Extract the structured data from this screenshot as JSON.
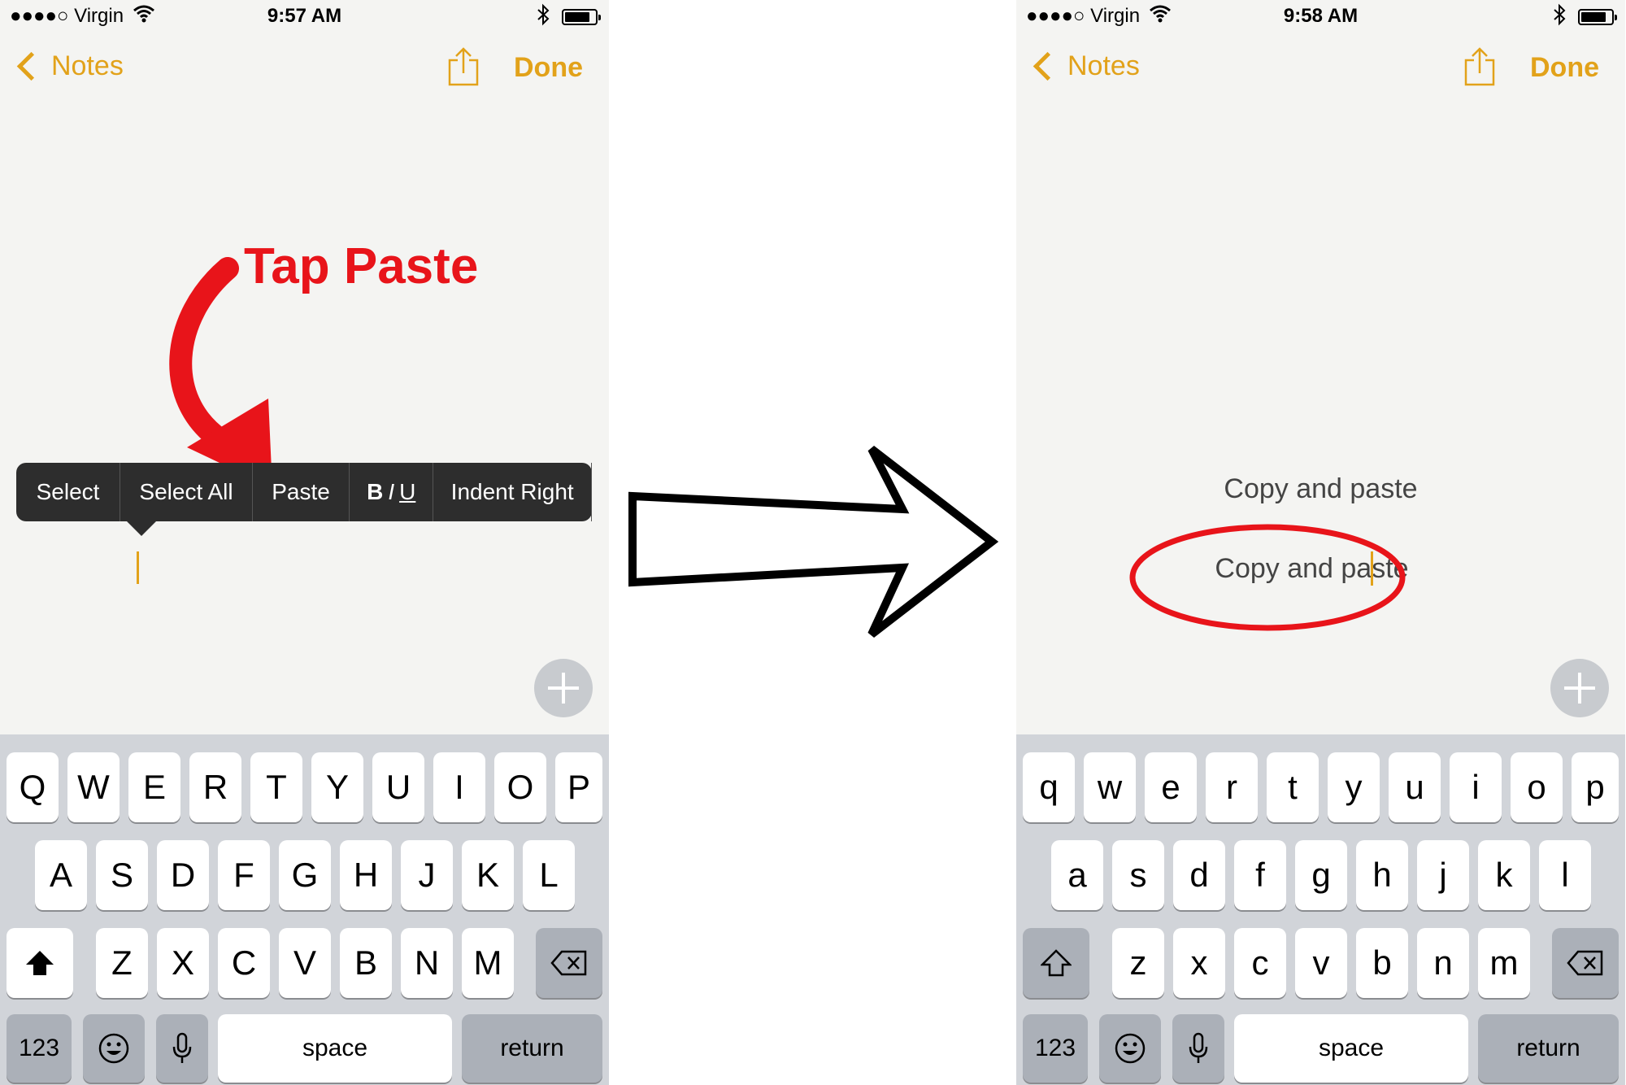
{
  "left": {
    "status": {
      "carrier": "●●●●○ Virgin",
      "time": "9:57 AM"
    },
    "nav": {
      "back_label": "Notes",
      "done_label": "Done"
    },
    "menu": {
      "select": "Select",
      "select_all": "Select All",
      "paste": "Paste",
      "biu_b": "B",
      "biu_i": "I",
      "biu_u": "U",
      "indent_right": "Indent Right"
    },
    "annotation": "Tap Paste",
    "keyboard": {
      "row1": [
        "Q",
        "W",
        "E",
        "R",
        "T",
        "Y",
        "U",
        "I",
        "O",
        "P"
      ],
      "row2": [
        "A",
        "S",
        "D",
        "F",
        "G",
        "H",
        "J",
        "K",
        "L"
      ],
      "row3": [
        "Z",
        "X",
        "C",
        "V",
        "B",
        "N",
        "M"
      ],
      "numbers": "123",
      "space": "space",
      "return": "return"
    }
  },
  "right": {
    "status": {
      "carrier": "●●●●○ Virgin",
      "time": "9:58 AM"
    },
    "nav": {
      "back_label": "Notes",
      "done_label": "Done"
    },
    "note_lines": [
      "Copy and paste",
      "Copy and paste"
    ],
    "keyboard": {
      "row1": [
        "q",
        "w",
        "e",
        "r",
        "t",
        "y",
        "u",
        "i",
        "o",
        "p"
      ],
      "row2": [
        "a",
        "s",
        "d",
        "f",
        "g",
        "h",
        "j",
        "k",
        "l"
      ],
      "row3": [
        "z",
        "x",
        "c",
        "v",
        "b",
        "n",
        "m"
      ],
      "numbers": "123",
      "space": "space",
      "return": "return"
    }
  },
  "colors": {
    "accent": "#e2a21a",
    "annotation": "#e8141a",
    "menu_bg": "#2d2d2d"
  },
  "icons": [
    "wifi-icon",
    "bluetooth-icon",
    "battery-icon",
    "share-icon",
    "plus-icon",
    "shift-icon",
    "delete-icon",
    "emoji-icon",
    "microphone-icon",
    "arrow-right-icon",
    "curved-arrow-icon"
  ]
}
